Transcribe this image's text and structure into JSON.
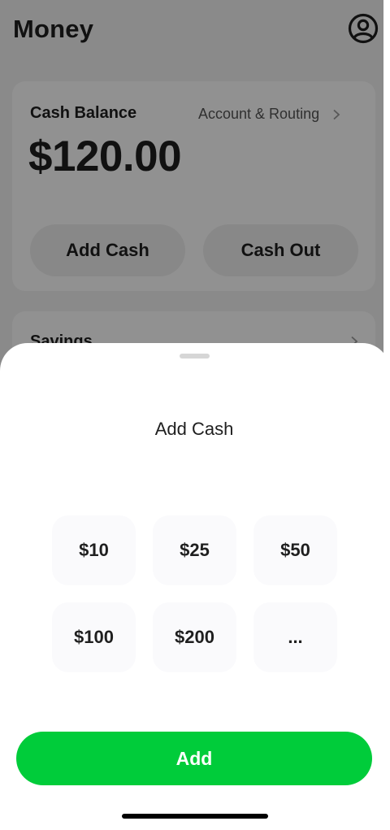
{
  "screen": {
    "title": "Money",
    "profile_icon": "person-circle-icon",
    "cash_card": {
      "label": "Cash Balance",
      "account_link": "Account & Routing",
      "balance": "$120.00",
      "add_cash": "Add Cash",
      "cash_out": "Cash Out"
    },
    "savings_card": {
      "label": "Savings"
    }
  },
  "sheet": {
    "title": "Add Cash",
    "amounts": [
      "$10",
      "$25",
      "$50",
      "$100",
      "$200",
      "..."
    ],
    "add_button": "Add"
  },
  "colors": {
    "accent_green": "#00cc3a",
    "amount_tile": "#fafafc",
    "scrim": "rgba(0,0,0,0.43)"
  }
}
